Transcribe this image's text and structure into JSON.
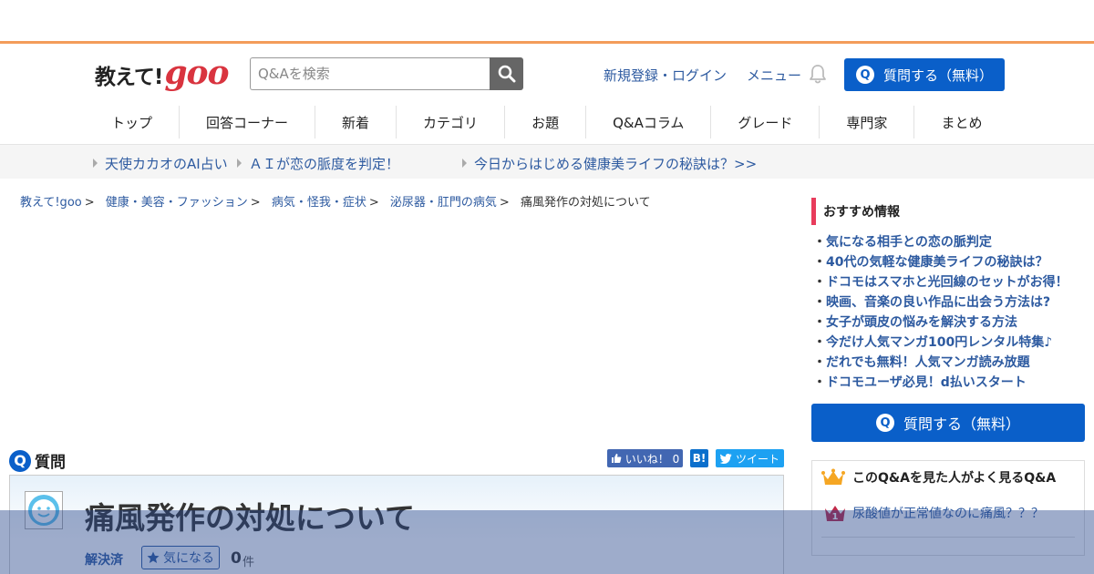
{
  "header": {
    "logo_jp": "教えて!",
    "logo_goo": "goo",
    "search_placeholder": "Q&Aを検索",
    "login_link": "新規登録・ログイン",
    "menu_link": "メニュー",
    "ask_button_label": "質問する（無料）"
  },
  "gnav": {
    "items": [
      "トップ",
      "回答コーナー",
      "新着",
      "カテゴリ",
      "お題",
      "Q&Aコラム",
      "グレード",
      "専門家",
      "まとめ"
    ]
  },
  "promo": {
    "items": [
      "天使カカオのAI占い",
      "ＡＩが恋の脈度を判定！",
      "今日からはじめる健康美ライフの秘訣は？>>"
    ]
  },
  "breadcrumb": {
    "items": [
      "教えて!goo",
      "健康・美容・ファッション",
      "病気・怪我・症状",
      "泌尿器・肛門の病気"
    ],
    "current": "痛風発作の対処について",
    "separator": ">"
  },
  "question": {
    "badge": "Q",
    "label": "質問",
    "title": "痛風発作の対処について",
    "status": "解決済",
    "watch_label": "気になる",
    "watch_count": "0",
    "watch_unit": "件"
  },
  "share": {
    "like_label": "いいね！ 0",
    "hatena_label": "B!",
    "tweet_label": "ツイート"
  },
  "sidebar": {
    "title": "おすすめ情報",
    "items": [
      "気になる相手との恋の脈判定",
      "40代の気軽な健康美ライフの秘訣は？",
      "ドコモはスマホと光回線のセットがお得！",
      "映画、音楽の良い作品に出会う方法は?",
      "女子が頭皮の悩みを解決する方法",
      "今だけ人気マンガ100円レンタル特集♪",
      "だれでも無料！人気マンガ読み放題",
      "ドコモユーザ必見！d払いスタート"
    ],
    "ask_button_label": "質問する（無料）",
    "popular_title": "このQ&Aを見た人がよく見るQ&A",
    "popular_items": [
      "尿酸値が正常値なのに痛風？？？"
    ]
  },
  "colors": {
    "accent_blue": "#0a5fc9",
    "link_blue": "#2d5aa0",
    "header_orange": "#f39c5a",
    "logo_red": "#d9343f"
  }
}
